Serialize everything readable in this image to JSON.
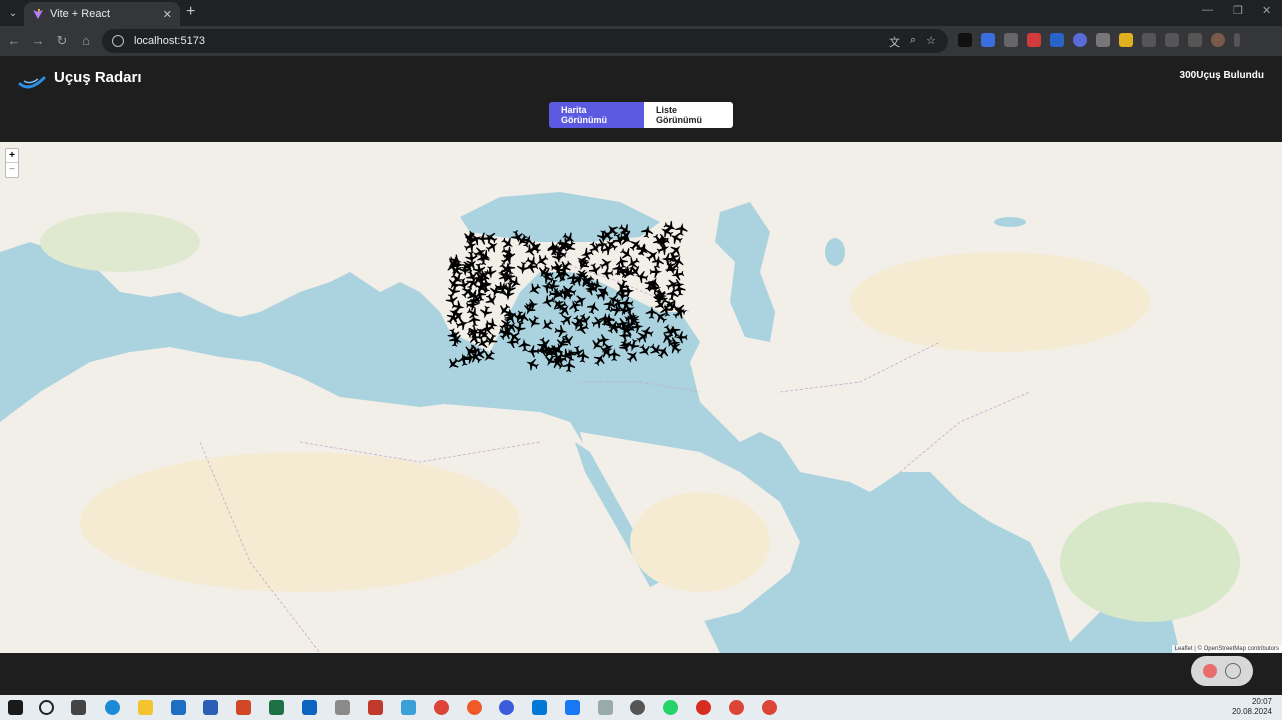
{
  "browser": {
    "tab_title": "Vite + React",
    "url": "localhost:5173"
  },
  "app": {
    "title": "Uçuş Radarı",
    "flights_found": "300Uçuş Bulundu",
    "views": {
      "map_label": "Harita Görünümü",
      "list_label": "Liste Görünümü"
    }
  },
  "map": {
    "zoom_in": "+",
    "zoom_out": "−",
    "attribution": "Leaflet | © OpenStreetMap contributors",
    "marker_count": 300
  },
  "taskbar": {
    "time": "20:07",
    "date": "20.08.2024"
  },
  "colors": {
    "accent": "#5b5ae0",
    "header_bg": "#1e1e1e",
    "sea": "#aad3df",
    "land": "#f2efe9"
  }
}
